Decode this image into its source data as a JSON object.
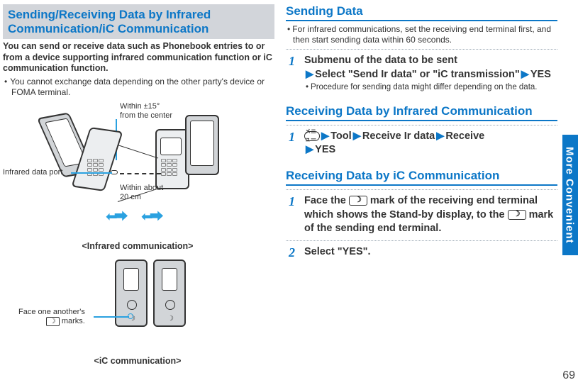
{
  "page_number": "69",
  "side_tab": "More Convenient",
  "left": {
    "section_title": "Sending/Receiving Data by Infrared Communication/iC Communication",
    "intro": "You can send or receive data such as Phonebook entries to or from a device supporting infrared communication function or iC communication function.",
    "bullet1": "You cannot exchange data depending on the other party's device or FOMA terminal.",
    "diagram1": {
      "within_angle": "Within ±15°",
      "from_center": "from the center",
      "port_label": "Infrared data port",
      "within_distance": "Within about 20 cm",
      "caption": "<Infrared communication>"
    },
    "diagram2": {
      "face_label_1": "Face one another's",
      "face_label_2": "marks.",
      "caption": "<iC communication>"
    }
  },
  "right": {
    "h1": "Sending Data",
    "h1_note": "For infrared communications, set the receiving end terminal first, and then start sending data within 60 seconds.",
    "s1_num": "1",
    "s1_txt_a": "Submenu of the data to be sent",
    "s1_txt_b": "Select \"Send Ir data\" or \"iC transmission\"",
    "s1_txt_c": "YES",
    "s1_sub": "Procedure for sending data might differ depending on the data.",
    "h2": "Receiving Data by Infrared Communication",
    "s2_num": "1",
    "s2_a": "Tool",
    "s2_b": "Receive Ir data",
    "s2_c": "Receive",
    "s2_d": "YES",
    "h3": "Receiving Data by iC Communication",
    "s3_num": "1",
    "s3_txt_a": "Face the",
    "s3_txt_b": "mark of the receiving end terminal which shows the Stand-by display, to the",
    "s3_txt_c": "mark of the sending end terminal.",
    "s4_num": "2",
    "s4_txt": "Select \"YES\".",
    "menu_glyph": "メニュー",
    "mark_glyph": "☽"
  }
}
